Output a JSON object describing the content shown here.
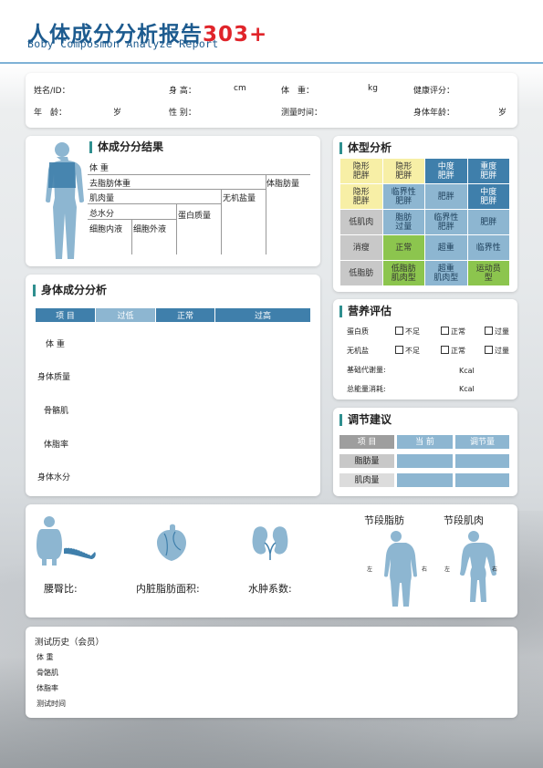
{
  "header": {
    "title": "人体成分分析报告",
    "title_num": "303+",
    "subtitle": "Boby Composmon Analyze Report"
  },
  "info": {
    "name_label": "姓名/ID：",
    "height_label": "身 高：",
    "height_unit": "cm",
    "weight_label": "体　重：",
    "weight_unit": "kg",
    "health_label": "健康评分：",
    "age_label": "年　龄：",
    "age_unit": "岁",
    "gender_label": "性 别：",
    "time_label": "测量时间：",
    "bodyage_label": "身体年龄：",
    "bodyage_unit": "岁"
  },
  "composition": {
    "title": "体成分分结果",
    "weight": "体 重",
    "lean": "去脂肪体重",
    "fat": "体脂肪量",
    "muscle": "肌肉量",
    "mineral": "无机盐量",
    "water": "总水分",
    "protein": "蛋白质量",
    "icw": "细胞内液",
    "ecw": "细胞外液"
  },
  "bodytype": {
    "title": "体型分析",
    "cells": [
      [
        "隐形\n肥胖",
        "隐形\n肥胖",
        "中度\n肥胖",
        "重度\n肥胖"
      ],
      [
        "隐形\n肥胖",
        "临界性\n肥胖",
        "肥胖",
        "中度\n肥胖"
      ],
      [
        "低肌肉",
        "脂肪\n过量",
        "临界性\n肥胖",
        "肥胖"
      ],
      [
        "消瘦",
        "正常",
        "超重",
        "临界性"
      ],
      [
        "低脂肪",
        "低脂肪\n肌肉型",
        "超重\n肌肉型",
        "运动员\n型"
      ]
    ],
    "colors": [
      [
        "#f7efa6",
        "#f7efa6",
        "#3f7fab",
        "#3f7fab"
      ],
      [
        "#f7efa6",
        "#8db6d1",
        "#8db6d1",
        "#3f7fab"
      ],
      [
        "#c8c8c8",
        "#8db6d1",
        "#8db6d1",
        "#8db6d1"
      ],
      [
        "#c8c8c8",
        "#8cc54e",
        "#8db6d1",
        "#8db6d1"
      ],
      [
        "#c8c8c8",
        "#8cc54e",
        "#8db6d1",
        "#8cc54e"
      ]
    ]
  },
  "analysis": {
    "title": "身体成分分析",
    "headers": [
      "项 目",
      "过低",
      "正常",
      "过高"
    ],
    "rows": [
      "体 重",
      "身体质量",
      "骨骼肌",
      "体脂率",
      "身体水分"
    ]
  },
  "nutrition": {
    "title": "营养评估",
    "protein": "蛋白质",
    "mineral": "无机盐",
    "options": [
      "不足",
      "正常",
      "过量"
    ],
    "bmr_label": "基础代谢量:",
    "bmr_unit": "Kcal",
    "energy_label": "总能量消耗:",
    "energy_unit": "Kcal"
  },
  "adjust": {
    "title": "调节建议",
    "headers": [
      "项 目",
      "当 前",
      "调节量"
    ],
    "rows": [
      "脂肪量",
      "肌肉量"
    ]
  },
  "indices": {
    "whr": "腰臀比:",
    "visceral": "内脏脂肪面积:",
    "edema": "水肿系数:",
    "seg_fat": "节段脂肪",
    "seg_muscle": "节段肌肉",
    "left": "左",
    "right": "右"
  },
  "history": {
    "title": "测试历史（会员）",
    "rows": [
      "体 重",
      "骨骼肌",
      "体脂率",
      "测试时间"
    ]
  },
  "colors": {
    "primary": "#1d5b8f",
    "accent_red": "#e0242a",
    "table_dark": "#3f7fab",
    "table_light": "#8db6d1",
    "figure": "#8db6d1"
  }
}
